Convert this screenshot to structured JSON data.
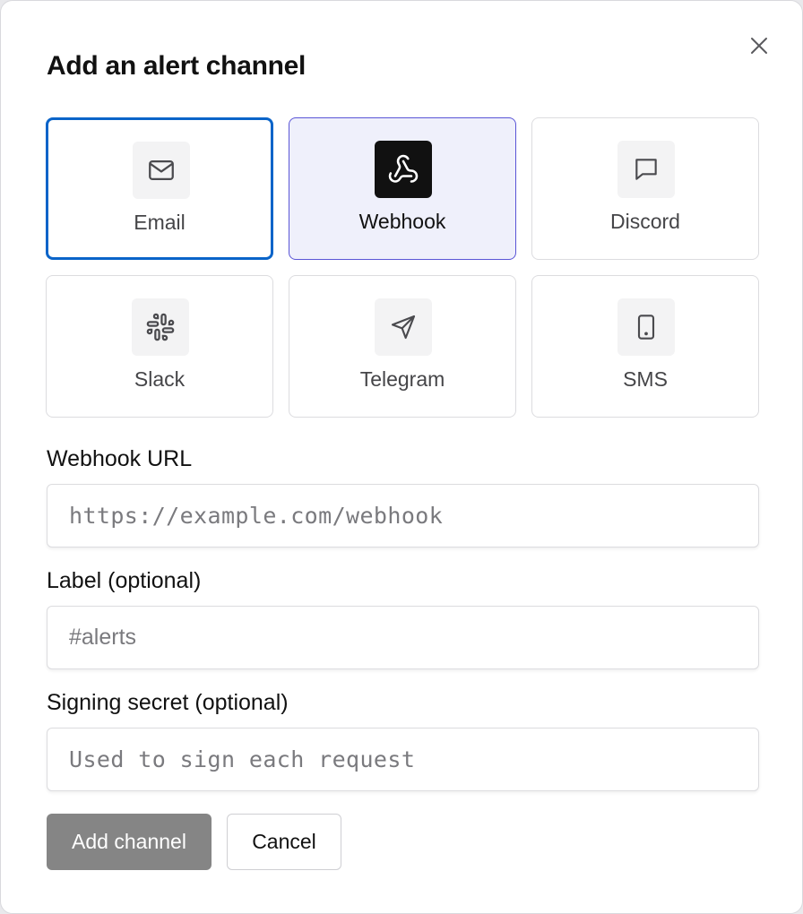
{
  "dialog": {
    "title": "Add an alert channel",
    "close_icon": "close-icon"
  },
  "channels": [
    {
      "label": "Email",
      "icon": "mail-icon",
      "state": "focused"
    },
    {
      "label": "Webhook",
      "icon": "webhook-icon",
      "state": "selected"
    },
    {
      "label": "Discord",
      "icon": "chat-bubble-icon",
      "state": "default"
    },
    {
      "label": "Slack",
      "icon": "slack-icon",
      "state": "default"
    },
    {
      "label": "Telegram",
      "icon": "paper-plane-icon",
      "state": "default"
    },
    {
      "label": "SMS",
      "icon": "phone-icon",
      "state": "default"
    }
  ],
  "form": {
    "url_label": "Webhook URL",
    "url_placeholder": "https://example.com/webhook",
    "label_label": "Label (optional)",
    "label_placeholder": "#alerts",
    "secret_label": "Signing secret (optional)",
    "secret_placeholder": "Used to sign each request"
  },
  "actions": {
    "submit_label": "Add channel",
    "cancel_label": "Cancel"
  },
  "colors": {
    "focus_ring": "#0a64c9",
    "selected_border": "#5a55d6",
    "selected_bg": "#eff0fb",
    "primary_disabled": "#858585"
  }
}
